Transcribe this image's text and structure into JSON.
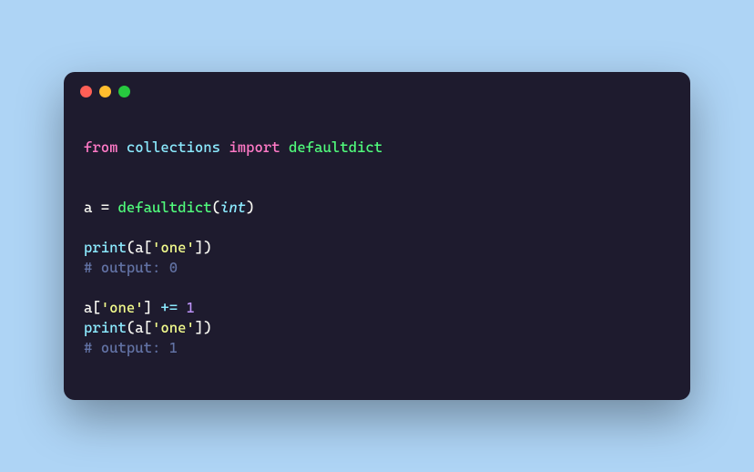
{
  "colors": {
    "background": "#aed4f5",
    "window_bg": "#1e1b2e",
    "dot_red": "#ff5f56",
    "dot_yellow": "#ffbd2e",
    "dot_green": "#27c93f"
  },
  "code": {
    "kw_from": "from",
    "kw_import": "import",
    "mod_collections": "collections",
    "fn_defaultdict": "defaultdict",
    "var_a": "a",
    "op_assign": "=",
    "op_pluseq": "+=",
    "type_int": "int",
    "fn_print": "print",
    "str_one": "'one'",
    "num_one": "1",
    "lparen": "(",
    "rparen": ")",
    "lbracket": "[",
    "rbracket": "]",
    "sp": " ",
    "comment_out0": "# output: 0",
    "comment_out1": "# output: 1"
  }
}
